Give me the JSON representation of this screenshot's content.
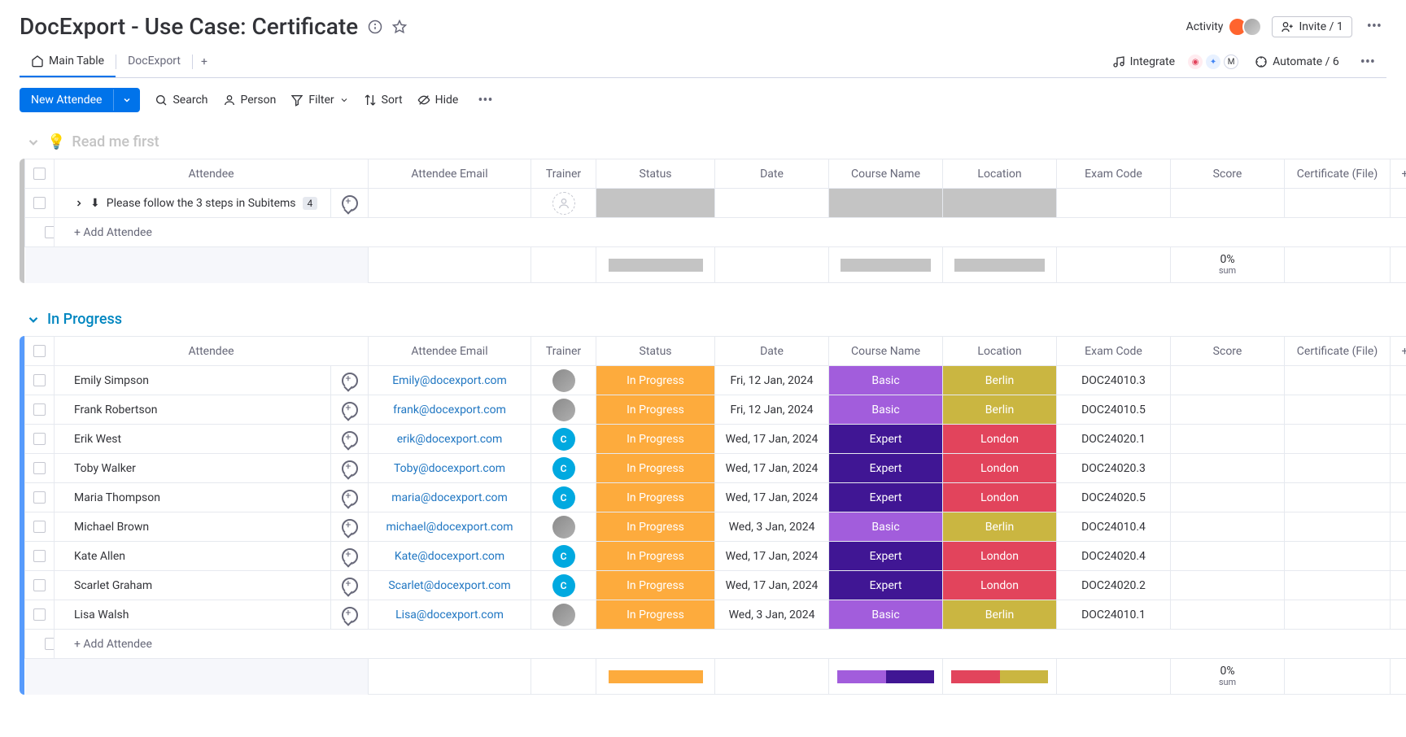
{
  "header": {
    "title": "DocExport - Use Case: Certificate",
    "activity": "Activity",
    "invite": "Invite / 1"
  },
  "tabs": {
    "main": "Main Table",
    "docexport": "DocExport",
    "integrate": "Integrate",
    "automate": "Automate / 6"
  },
  "toolbar": {
    "new": "New Attendee",
    "search": "Search",
    "person": "Person",
    "filter": "Filter",
    "sort": "Sort",
    "hide": "Hide"
  },
  "columns": {
    "attendee": "Attendee",
    "email": "Attendee Email",
    "trainer": "Trainer",
    "status": "Status",
    "date": "Date",
    "course": "Course Name",
    "location": "Location",
    "exam": "Exam Code",
    "score": "Score",
    "cert": "Certificate (File)"
  },
  "groups": {
    "readme": {
      "title": "Read me first",
      "row_label": "Please follow the 3 steps in Subitems",
      "subcount": "4",
      "add": "+ Add Attendee",
      "footer_score": "0%",
      "footer_sum": "sum"
    },
    "inprogress": {
      "title": "In Progress",
      "add": "+ Add Attendee",
      "footer_score": "0%",
      "footer_sum": "sum",
      "rows": [
        {
          "name": "Emily Simpson",
          "email": "Emily@docexport.com",
          "trainer": "img",
          "status": "In Progress",
          "date": "Fri, 12 Jan, 2024",
          "course": "Basic",
          "location": "Berlin",
          "exam": "DOC24010.3"
        },
        {
          "name": "Frank Robertson",
          "email": "frank@docexport.com",
          "trainer": "img",
          "status": "In Progress",
          "date": "Fri, 12 Jan, 2024",
          "course": "Basic",
          "location": "Berlin",
          "exam": "DOC24010.5"
        },
        {
          "name": "Erik West",
          "email": "erik@docexport.com",
          "trainer": "C",
          "status": "In Progress",
          "date": "Wed, 17 Jan, 2024",
          "course": "Expert",
          "location": "London",
          "exam": "DOC24020.1"
        },
        {
          "name": "Toby Walker",
          "email": "Toby@docexport.com",
          "trainer": "C",
          "status": "In Progress",
          "date": "Wed, 17 Jan, 2024",
          "course": "Expert",
          "location": "London",
          "exam": "DOC24020.3"
        },
        {
          "name": "Maria Thompson",
          "email": "maria@docexport.com",
          "trainer": "C",
          "status": "In Progress",
          "date": "Wed, 17 Jan, 2024",
          "course": "Expert",
          "location": "London",
          "exam": "DOC24020.5"
        },
        {
          "name": "Michael Brown",
          "email": "michael@docexport.com",
          "trainer": "img",
          "status": "In Progress",
          "date": "Wed, 3 Jan, 2024",
          "course": "Basic",
          "location": "Berlin",
          "exam": "DOC24010.4"
        },
        {
          "name": "Kate Allen",
          "email": "Kate@docexport.com",
          "trainer": "C",
          "status": "In Progress",
          "date": "Wed, 17 Jan, 2024",
          "course": "Expert",
          "location": "London",
          "exam": "DOC24020.4"
        },
        {
          "name": "Scarlet Graham",
          "email": "Scarlet@docexport.com",
          "trainer": "C",
          "status": "In Progress",
          "date": "Wed, 17 Jan, 2024",
          "course": "Expert",
          "location": "London",
          "exam": "DOC24020.2"
        },
        {
          "name": "Lisa Walsh",
          "email": "Lisa@docexport.com",
          "trainer": "img",
          "status": "In Progress",
          "date": "Wed, 3 Jan, 2024",
          "course": "Basic",
          "location": "Berlin",
          "exam": "DOC24010.1"
        }
      ]
    }
  }
}
